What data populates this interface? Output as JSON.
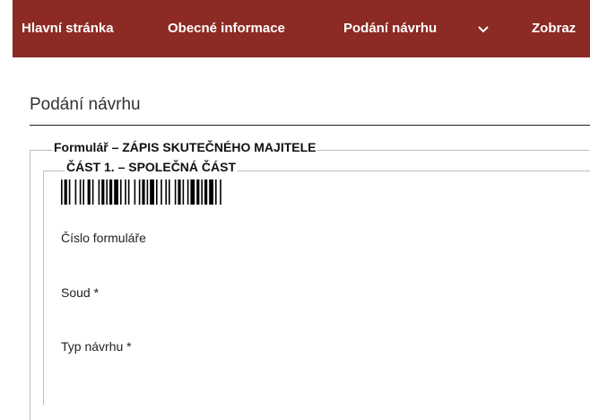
{
  "nav": {
    "items": [
      "Hlavní stránka",
      "Obecné informace",
      "Podání návrhu",
      "Zobraz"
    ],
    "chevron": "chevron-down-icon",
    "background": "#8c2a24"
  },
  "page": {
    "title": "Podání návrhu"
  },
  "form": {
    "legend": "Formulář – ZÁPIS SKUTEČNÉHO MAJITELE",
    "section": {
      "legend": "ČÁST 1. – SPOLEČNÁ ČÁST",
      "fields": [
        "Číslo formuláře",
        "Soud *",
        "Typ návrhu *"
      ]
    }
  }
}
